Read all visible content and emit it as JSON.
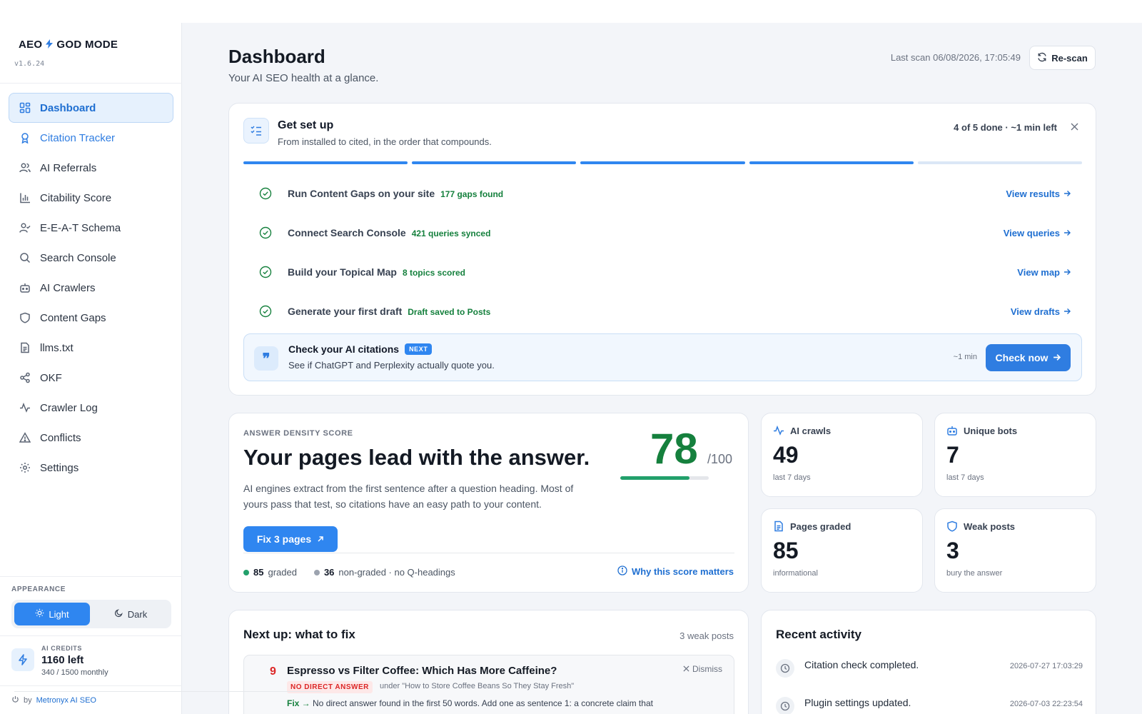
{
  "app": {
    "brand_left": "AEO",
    "brand_right": "GOD MODE",
    "version": "v1.6.24"
  },
  "sidebar": {
    "items": [
      {
        "label": "Dashboard",
        "icon": "grid-icon"
      },
      {
        "label": "Citation Tracker",
        "icon": "award-icon"
      },
      {
        "label": "AI Referrals",
        "icon": "users-icon"
      },
      {
        "label": "Citability Score",
        "icon": "bar-chart-icon"
      },
      {
        "label": "E-E-A-T Schema",
        "icon": "user-check-icon"
      },
      {
        "label": "Search Console",
        "icon": "search-icon"
      },
      {
        "label": "AI Crawlers",
        "icon": "bot-icon"
      },
      {
        "label": "Content Gaps",
        "icon": "shield-icon"
      },
      {
        "label": "llms.txt",
        "icon": "file-icon"
      },
      {
        "label": "OKF",
        "icon": "share-icon"
      },
      {
        "label": "Crawler Log",
        "icon": "activity-icon"
      },
      {
        "label": "Conflicts",
        "icon": "warning-icon"
      },
      {
        "label": "Settings",
        "icon": "gear-icon"
      }
    ],
    "appearance_label": "APPEARANCE",
    "theme_light": "Light",
    "theme_dark": "Dark",
    "credits_label": "AI CREDITS",
    "credits_left": "1160 left",
    "credits_sub": "340 / 1500 monthly",
    "by_text": "by",
    "by_link": "Metronyx AI SEO"
  },
  "header": {
    "title": "Dashboard",
    "subtitle": "Your AI SEO health at a glance.",
    "last_scan": "Last scan 06/08/2026, 17:05:49",
    "rescan": "Re-scan"
  },
  "setup": {
    "title": "Get set up",
    "subtitle": "From installed to cited, in the order that compounds.",
    "progress_text": "4 of 5 done · ~1 min left",
    "segments_done": 4,
    "segments_total": 5,
    "steps": [
      {
        "label": "Run Content Gaps on your site",
        "badge": "177 gaps found",
        "link": "View results"
      },
      {
        "label": "Connect Search Console",
        "badge": "421 queries synced",
        "link": "View queries"
      },
      {
        "label": "Build your Topical Map",
        "badge": "8 topics scored",
        "link": "View map"
      },
      {
        "label": "Generate your first draft",
        "badge": "Draft saved to Posts",
        "link": "View drafts"
      }
    ],
    "next": {
      "title": "Check your AI citations",
      "badge": "NEXT",
      "subtitle": "See if ChatGPT and Perplexity actually quote you.",
      "time": "~1 min",
      "button": "Check now"
    }
  },
  "density": {
    "label": "ANSWER DENSITY SCORE",
    "headline": "Your pages lead with the answer.",
    "body": "AI engines extract from the first sentence after a question heading. Most of yours pass that test, so citations have an easy path to your content.",
    "score": "78",
    "score_max": "/100",
    "score_fraction": 0.78,
    "fix_button": "Fix 3 pages",
    "graded_count": "85",
    "graded_label": "graded",
    "nongraded_count": "36",
    "nongraded_label": "non-graded · no Q-headings",
    "why_link": "Why this score matters",
    "colors": {
      "score": "#15803d",
      "graded_dot": "#22a06b",
      "nongraded_dot": "#9ca3af"
    }
  },
  "stats": [
    {
      "title": "AI crawls",
      "value": "49",
      "sub": "last 7 days",
      "icon": "activity-icon"
    },
    {
      "title": "Unique bots",
      "value": "7",
      "sub": "last 7 days",
      "icon": "bot-icon"
    },
    {
      "title": "Pages graded",
      "value": "85",
      "sub": "informational",
      "icon": "file-icon"
    },
    {
      "title": "Weak posts",
      "value": "3",
      "sub": "bury the answer",
      "icon": "shield-icon"
    }
  ],
  "fix_list": {
    "title": "Next up: what to fix",
    "count": "3 weak posts",
    "items": [
      {
        "num": "9",
        "post": "Espresso vs Filter Coffee: Which Has More Caffeine?",
        "dismiss": "Dismiss",
        "tag": "NO DIRECT ANSWER",
        "under": "under \"How to Store Coffee Beans So They Stay Fresh\"",
        "fix_label": "Fix →",
        "fix_text": "No direct answer found in the first 50 words. Add one as sentence 1: a concrete claim that"
      }
    ]
  },
  "activity": {
    "title": "Recent activity",
    "items": [
      {
        "text": "Citation check completed.",
        "time": "2026-07-27 17:03:29"
      },
      {
        "text": "Plugin settings updated.",
        "time": "2026-07-03 22:23:54"
      }
    ]
  }
}
